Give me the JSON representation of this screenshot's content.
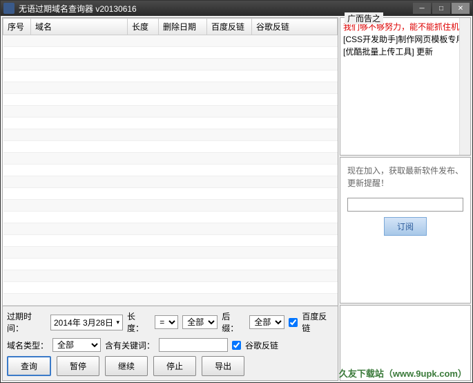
{
  "titlebar": {
    "title": "无语过期域名查询器 v20130616"
  },
  "table": {
    "headers": [
      "序号",
      "域名",
      "长度",
      "删除日期",
      "百度反链",
      "谷歌反链"
    ]
  },
  "controls": {
    "expire_label": "过期时间：",
    "expire_date": "2014年 3月28日",
    "length_label": "长度：",
    "length_op": "=",
    "length_val": "全部",
    "suffix_label": "后缀：",
    "suffix_val": "全部",
    "baidu_check": "百度反链",
    "type_label": "域名类型：",
    "type_val": "全部",
    "keyword_label": "含有关键词：",
    "keyword_val": "",
    "google_check": "谷歌反链",
    "btn_query": "查询",
    "btn_pause": "暂停",
    "btn_continue": "继续",
    "btn_stop": "停止",
    "btn_export": "导出"
  },
  "ad": {
    "title": "广而告之",
    "line1": "我们够不够努力，能不能抓住机",
    "line2": "[CSS开发助手]制作网页模板专用",
    "line3": "[优酷批量上传工具] 更新"
  },
  "subscribe": {
    "text": "现在加入，获取最新软件发布、更新提醒！",
    "btn": "订阅"
  },
  "watermark": "久友下载站（www.9upk.com）"
}
